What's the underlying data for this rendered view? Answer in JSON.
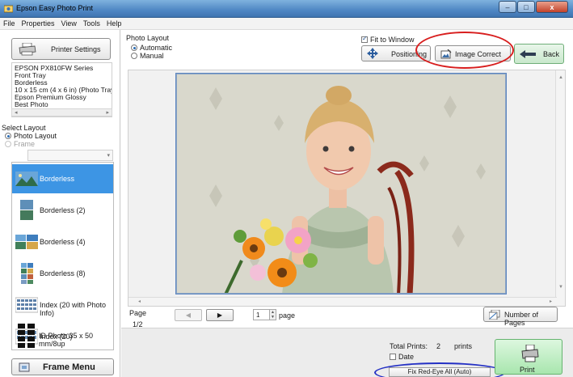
{
  "window": {
    "title": "Epson Easy Photo Print",
    "controls": [
      "‒",
      "□",
      "x"
    ]
  },
  "menu": [
    "File",
    "Properties",
    "View",
    "Tools",
    "Help"
  ],
  "left": {
    "printer_settings_label": "Printer Settings",
    "printer_info": [
      "EPSON PX810FW Series",
      "Front Tray",
      "Borderless",
      "10 x 15 cm (4 x 6 in) (Photo Tray)",
      "Epson Premium Glossy",
      "Best Photo"
    ],
    "select_layout_label": "Select Layout",
    "photo_layout_option": "Photo Layout",
    "frame_option": "Frame",
    "layouts": [
      {
        "label": "Borderless",
        "selected": true
      },
      {
        "label": "Borderless (2)",
        "selected": false
      },
      {
        "label": "Borderless (4)",
        "selected": false
      },
      {
        "label": "Borderless (8)",
        "selected": false
      },
      {
        "label": "Index (20 with Photo Info)",
        "selected": false
      },
      {
        "label": "Index (20)",
        "selected": false
      },
      {
        "label": "ID Photo 35 x 50 mm/8up",
        "selected": false
      }
    ],
    "frame_menu_label": "Frame Menu"
  },
  "main": {
    "photo_layout_label": "Photo Layout",
    "automatic_label": "Automatic",
    "manual_label": "Manual",
    "fit_to_window_label": "Fit to Window",
    "fit_to_window_checked": true,
    "positioning_label": "Positioning",
    "image_correct_label": "Image Correct",
    "back_label": "Back",
    "page_label": "Page",
    "page_fraction": "1/2",
    "page_value": "1",
    "page_word": "page",
    "number_of_pages_label": "Number of Pages"
  },
  "bottom": {
    "total_prints_label": "Total Prints:",
    "total_prints_value": "2",
    "total_prints_unit": "prints",
    "date_label": "Date",
    "fix_redeye_label": "Fix Red-Eye All (Auto)",
    "print_label": "Print"
  },
  "colors": {
    "selection_blue": "#3d95e4",
    "annotation_red": "#d81e1e",
    "annotation_blue": "#2430c4",
    "print_green": "#a8e6ae"
  },
  "icons": {
    "printer_settings": "printer-icon",
    "positioning": "move-arrows-icon",
    "image_correct": "image-correct-icon",
    "back": "back-arrow-icon",
    "number_of_pages": "pages-icon",
    "print": "printer-icon",
    "frame_menu": "frame-icon"
  }
}
